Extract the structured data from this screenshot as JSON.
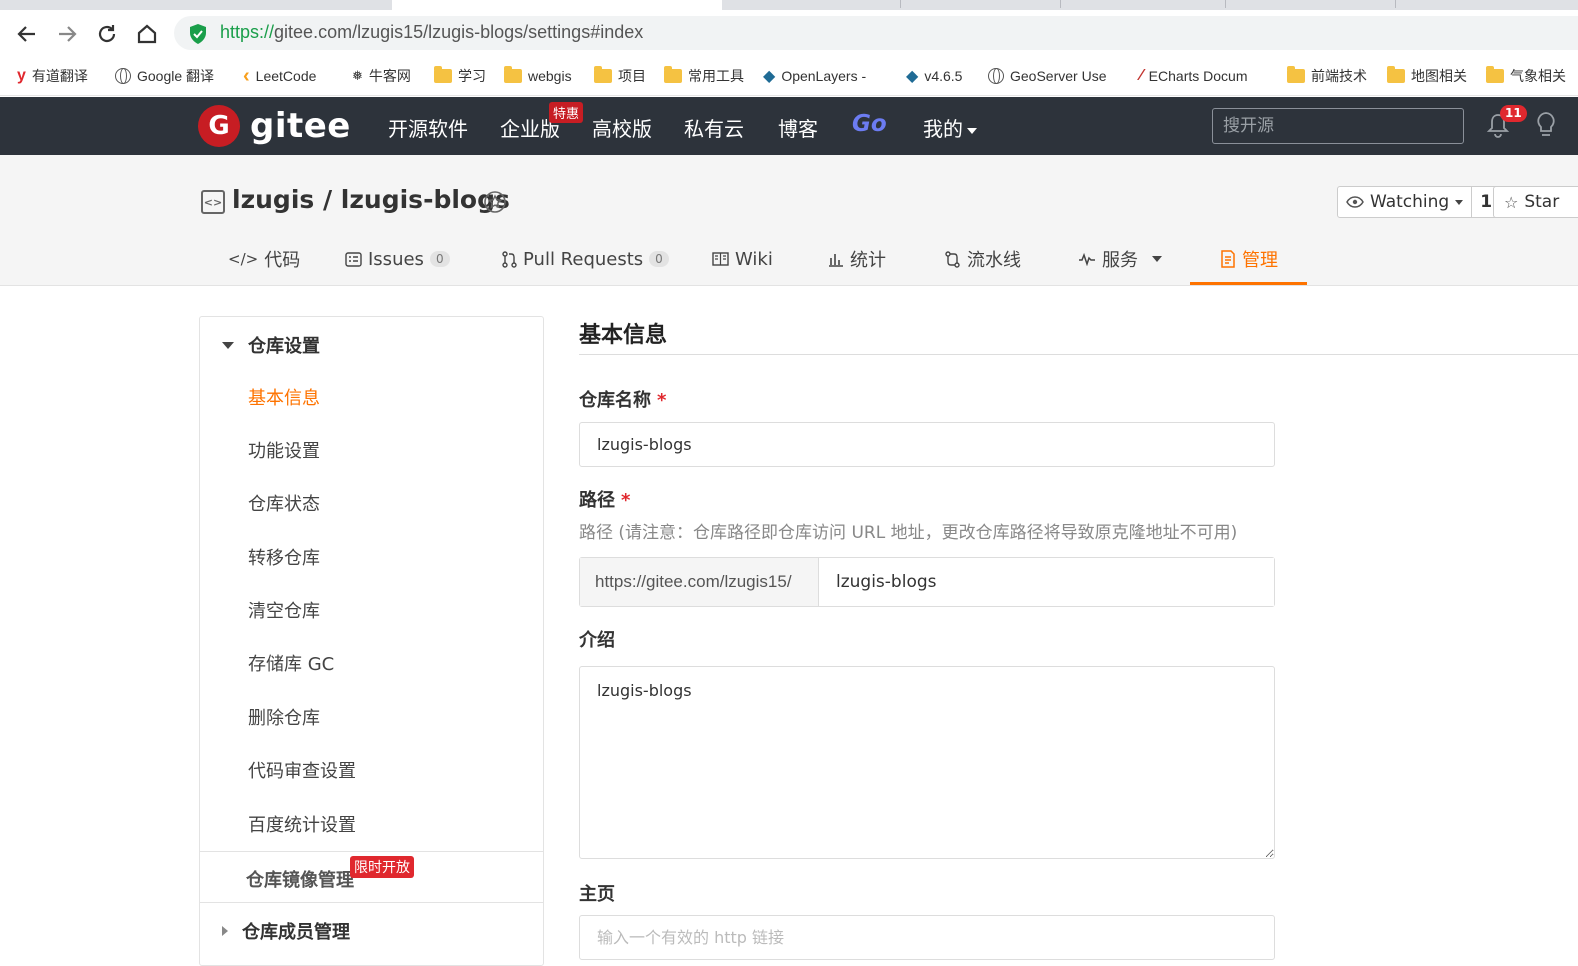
{
  "browser": {
    "url_scheme": "https://",
    "url_rest": "gitee.com/lzugis15/lzugis-blogs/settings#index",
    "bookmarks": [
      {
        "label": "有道翻译",
        "icon": "youdao-icon"
      },
      {
        "label": "Google 翻译",
        "icon": "globe-icon"
      },
      {
        "label": "LeetCode",
        "icon": "leetcode-icon"
      },
      {
        "label": "牛客网",
        "icon": "nowcoder-icon"
      },
      {
        "label": "学习",
        "icon": "folder-icon"
      },
      {
        "label": "webgis",
        "icon": "folder-icon"
      },
      {
        "label": "项目",
        "icon": "folder-icon"
      },
      {
        "label": "常用工具",
        "icon": "folder-icon"
      },
      {
        "label": "OpenLayers -",
        "icon": "openlayers-icon"
      },
      {
        "label": "v4.6.5",
        "icon": "openlayers-icon"
      },
      {
        "label": "GeoServer Use",
        "icon": "globe-icon"
      },
      {
        "label": "ECharts Docum",
        "icon": "echarts-icon"
      },
      {
        "label": "前端技术",
        "icon": "folder-icon"
      },
      {
        "label": "地图相关",
        "icon": "folder-icon"
      },
      {
        "label": "气象相关",
        "icon": "folder-icon"
      }
    ]
  },
  "header": {
    "logo_letter": "G",
    "logo_text": "gitee",
    "nav": [
      "开源软件",
      "企业版",
      "高校版",
      "私有云",
      "博客",
      "Go",
      "我的"
    ],
    "hot_badge": "特惠",
    "search_placeholder": "搜开源",
    "notification_count": "11"
  },
  "project": {
    "title": "lzugis / lzugis-blogs",
    "watch_label": "Watching",
    "watch_count": "1",
    "star_label": "Star",
    "tabs": [
      {
        "label": "代码",
        "icon": "code-icon"
      },
      {
        "label": "Issues",
        "count": "0",
        "icon": "issues-icon"
      },
      {
        "label": "Pull Requests",
        "count": "0",
        "icon": "pull-request-icon"
      },
      {
        "label": "Wiki",
        "icon": "wiki-icon"
      },
      {
        "label": "统计",
        "icon": "stats-icon"
      },
      {
        "label": "流水线",
        "icon": "pipeline-icon"
      },
      {
        "label": "服务",
        "icon": "service-icon"
      },
      {
        "label": "管理",
        "icon": "manage-icon"
      }
    ]
  },
  "sidebar": {
    "group_repo": "仓库设置",
    "items": [
      "基本信息",
      "功能设置",
      "仓库状态",
      "转移仓库",
      "清空仓库",
      "存储库 GC",
      "删除仓库",
      "代码审查设置",
      "百度统计设置"
    ],
    "mirror": "仓库镜像管理",
    "limited_badge": "限时开放",
    "members": "仓库成员管理"
  },
  "form": {
    "section_title": "基本信息",
    "name_label": "仓库名称",
    "required_mark": "*",
    "name_value": "lzugis-blogs",
    "path_label": "路径",
    "path_hint": "路径 (请注意：仓库路径即仓库访问 URL 地址，更改仓库路径将导致原克隆地址不可用)",
    "path_prefix": "https://gitee.com/lzugis15/",
    "path_value": "lzugis-blogs",
    "intro_label": "介绍",
    "intro_value": "lzugis-blogs",
    "homepage_label": "主页",
    "homepage_placeholder": "输入一个有效的 http 链接"
  },
  "colors": {
    "accent": "#fe7300",
    "header_bg": "#2d333b",
    "brand_red": "#c71d23"
  }
}
